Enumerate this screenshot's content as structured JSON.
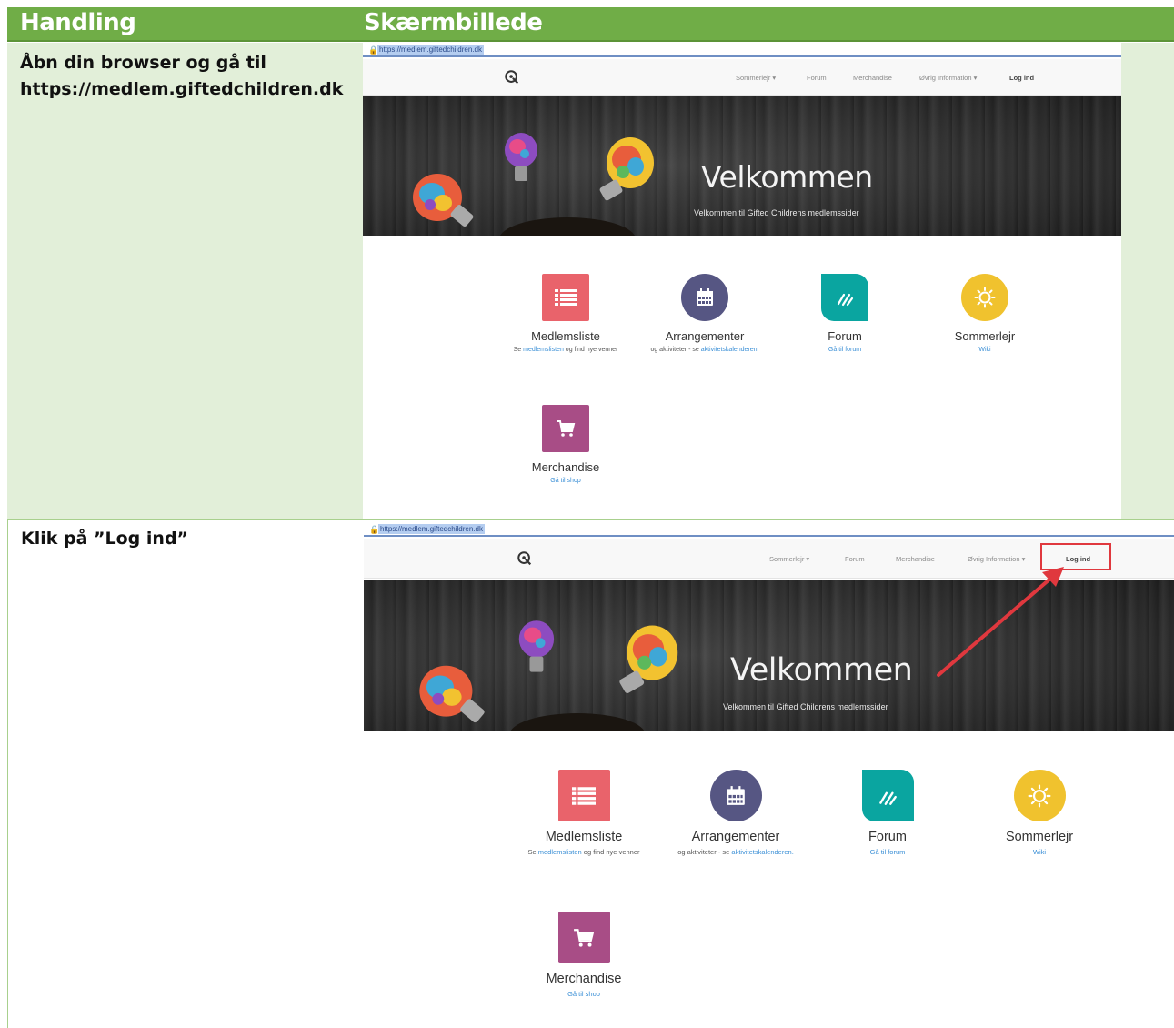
{
  "header": {
    "col1": "Handling",
    "col2": "Skærmbillede"
  },
  "steps": [
    {
      "text_line1": "Åbn din browser og gå til",
      "text_line2": "https://medlem.giftedchildren.dk"
    },
    {
      "text": "Klik på ”Log ind”"
    }
  ],
  "screenshot": {
    "url": "https://medlem.giftedchildren.dk",
    "nav": {
      "sommerlejr": "Sommerlejr ▾",
      "forum": "Forum",
      "merchandise": "Merchandise",
      "oevrig": "Øvrig Information ▾",
      "login": "Log ind"
    },
    "hero": {
      "title": "Velkommen",
      "subtitle": "Velkommen til Gifted Childrens medlemssider"
    },
    "cards": {
      "medlemsliste": {
        "title": "Medlemsliste",
        "desc_pre": "Se ",
        "desc_link": "medlemslisten",
        "desc_post": " og find nye venner",
        "icon": "list-icon"
      },
      "arrangementer": {
        "title": "Arrangementer",
        "desc_pre": "og aktiviteter - se ",
        "desc_link": "aktivitetskalenderen.",
        "icon": "calendar-icon"
      },
      "forum": {
        "title": "Forum",
        "desc_link": "Gå til forum",
        "icon": "forum-icon"
      },
      "sommerlejr": {
        "title": "Sommerlejr",
        "desc_link": "Wiki",
        "icon": "sun-icon"
      },
      "merchandise": {
        "title": "Merchandise",
        "desc_link": "Gå til shop",
        "icon": "cart-icon"
      }
    }
  },
  "colors": {
    "header_green": "#70ad47",
    "row_light_green": "#e2efd9",
    "highlight_red": "#e0383e"
  }
}
